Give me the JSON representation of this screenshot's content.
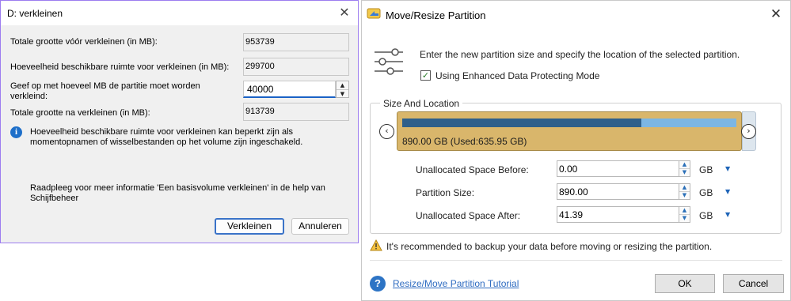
{
  "shrink_dialog": {
    "title": "D: verkleinen",
    "close_icon": "close-icon",
    "fields": [
      {
        "label": "Totale grootte vóór verkleinen (in MB):",
        "value": "953739"
      },
      {
        "label": "Hoeveelheid beschikbare ruimte voor verkleinen (in MB):",
        "value": "299700"
      },
      {
        "label": "Geef op met hoeveel MB de partitie moet worden verkleind:",
        "value": "40000"
      },
      {
        "label": "Totale grootte na verkleinen (in MB):",
        "value": "913739"
      }
    ],
    "info_icon": "info-icon",
    "info_text": "Hoeveelheid beschikbare ruimte voor verkleinen kan beperkt zijn als momentopnamen of wisselbestanden op het volume zijn ingeschakeld.",
    "help_text": "Raadpleeg voor meer informatie 'Een basisvolume verkleinen' in de help van Schijfbeheer",
    "shrink_button": "Verkleinen",
    "cancel_button": "Annuleren",
    "accent": "#9d7df0"
  },
  "resize_dialog": {
    "title": "Move/Resize Partition",
    "app_icon": "move-resize-app-icon",
    "close_icon": "close-icon",
    "intro_icon": "sliders-icon",
    "intro": "Enter the new partition size and specify the location of the selected partition.",
    "protect_mode": {
      "label": "Using Enhanced Data Protecting Mode",
      "checked": true
    },
    "group_title": "Size And Location",
    "partition": {
      "label": "890.00 GB (Used:635.95 GB)",
      "size_gb": 890.0,
      "used_gb": 635.95,
      "fill_color": "#d9b66b",
      "used_color": "#2e5f8a",
      "free_color": "#7cb6e3"
    },
    "nav_left_icon": "chevron-left-icon",
    "nav_right_icon": "chevron-right-icon",
    "rows": [
      {
        "label": "Unallocated Space Before:",
        "value": "0.00",
        "unit": "GB"
      },
      {
        "label": "Partition Size:",
        "value": "890.00",
        "unit": "GB"
      },
      {
        "label": "Unallocated Space After:",
        "value": "41.39",
        "unit": "GB"
      }
    ],
    "warning_icon": "warning-icon",
    "warning": "It's recommended to backup your data before moving or resizing the partition.",
    "help_icon": "help-icon",
    "tutorial_link": "Resize/Move Partition Tutorial",
    "ok_button": "OK",
    "cancel_button": "Cancel"
  }
}
